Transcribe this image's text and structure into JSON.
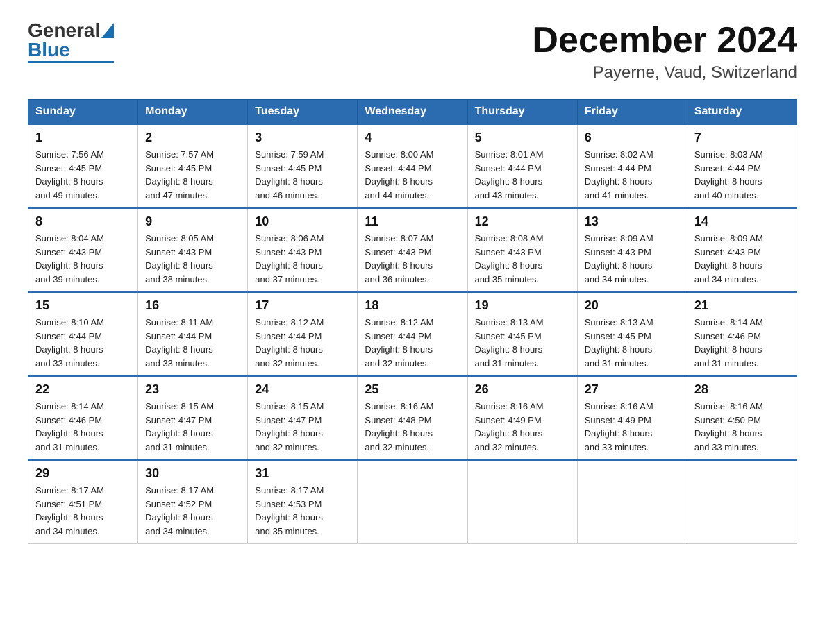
{
  "header": {
    "logo_general": "General",
    "logo_blue": "Blue",
    "title": "December 2024",
    "location": "Payerne, Vaud, Switzerland"
  },
  "days_of_week": [
    "Sunday",
    "Monday",
    "Tuesday",
    "Wednesday",
    "Thursday",
    "Friday",
    "Saturday"
  ],
  "weeks": [
    [
      {
        "day": "1",
        "sunrise": "7:56 AM",
        "sunset": "4:45 PM",
        "daylight": "8 hours and 49 minutes."
      },
      {
        "day": "2",
        "sunrise": "7:57 AM",
        "sunset": "4:45 PM",
        "daylight": "8 hours and 47 minutes."
      },
      {
        "day": "3",
        "sunrise": "7:59 AM",
        "sunset": "4:45 PM",
        "daylight": "8 hours and 46 minutes."
      },
      {
        "day": "4",
        "sunrise": "8:00 AM",
        "sunset": "4:44 PM",
        "daylight": "8 hours and 44 minutes."
      },
      {
        "day": "5",
        "sunrise": "8:01 AM",
        "sunset": "4:44 PM",
        "daylight": "8 hours and 43 minutes."
      },
      {
        "day": "6",
        "sunrise": "8:02 AM",
        "sunset": "4:44 PM",
        "daylight": "8 hours and 41 minutes."
      },
      {
        "day": "7",
        "sunrise": "8:03 AM",
        "sunset": "4:44 PM",
        "daylight": "8 hours and 40 minutes."
      }
    ],
    [
      {
        "day": "8",
        "sunrise": "8:04 AM",
        "sunset": "4:43 PM",
        "daylight": "8 hours and 39 minutes."
      },
      {
        "day": "9",
        "sunrise": "8:05 AM",
        "sunset": "4:43 PM",
        "daylight": "8 hours and 38 minutes."
      },
      {
        "day": "10",
        "sunrise": "8:06 AM",
        "sunset": "4:43 PM",
        "daylight": "8 hours and 37 minutes."
      },
      {
        "day": "11",
        "sunrise": "8:07 AM",
        "sunset": "4:43 PM",
        "daylight": "8 hours and 36 minutes."
      },
      {
        "day": "12",
        "sunrise": "8:08 AM",
        "sunset": "4:43 PM",
        "daylight": "8 hours and 35 minutes."
      },
      {
        "day": "13",
        "sunrise": "8:09 AM",
        "sunset": "4:43 PM",
        "daylight": "8 hours and 34 minutes."
      },
      {
        "day": "14",
        "sunrise": "8:09 AM",
        "sunset": "4:43 PM",
        "daylight": "8 hours and 34 minutes."
      }
    ],
    [
      {
        "day": "15",
        "sunrise": "8:10 AM",
        "sunset": "4:44 PM",
        "daylight": "8 hours and 33 minutes."
      },
      {
        "day": "16",
        "sunrise": "8:11 AM",
        "sunset": "4:44 PM",
        "daylight": "8 hours and 33 minutes."
      },
      {
        "day": "17",
        "sunrise": "8:12 AM",
        "sunset": "4:44 PM",
        "daylight": "8 hours and 32 minutes."
      },
      {
        "day": "18",
        "sunrise": "8:12 AM",
        "sunset": "4:44 PM",
        "daylight": "8 hours and 32 minutes."
      },
      {
        "day": "19",
        "sunrise": "8:13 AM",
        "sunset": "4:45 PM",
        "daylight": "8 hours and 31 minutes."
      },
      {
        "day": "20",
        "sunrise": "8:13 AM",
        "sunset": "4:45 PM",
        "daylight": "8 hours and 31 minutes."
      },
      {
        "day": "21",
        "sunrise": "8:14 AM",
        "sunset": "4:46 PM",
        "daylight": "8 hours and 31 minutes."
      }
    ],
    [
      {
        "day": "22",
        "sunrise": "8:14 AM",
        "sunset": "4:46 PM",
        "daylight": "8 hours and 31 minutes."
      },
      {
        "day": "23",
        "sunrise": "8:15 AM",
        "sunset": "4:47 PM",
        "daylight": "8 hours and 31 minutes."
      },
      {
        "day": "24",
        "sunrise": "8:15 AM",
        "sunset": "4:47 PM",
        "daylight": "8 hours and 32 minutes."
      },
      {
        "day": "25",
        "sunrise": "8:16 AM",
        "sunset": "4:48 PM",
        "daylight": "8 hours and 32 minutes."
      },
      {
        "day": "26",
        "sunrise": "8:16 AM",
        "sunset": "4:49 PM",
        "daylight": "8 hours and 32 minutes."
      },
      {
        "day": "27",
        "sunrise": "8:16 AM",
        "sunset": "4:49 PM",
        "daylight": "8 hours and 33 minutes."
      },
      {
        "day": "28",
        "sunrise": "8:16 AM",
        "sunset": "4:50 PM",
        "daylight": "8 hours and 33 minutes."
      }
    ],
    [
      {
        "day": "29",
        "sunrise": "8:17 AM",
        "sunset": "4:51 PM",
        "daylight": "8 hours and 34 minutes."
      },
      {
        "day": "30",
        "sunrise": "8:17 AM",
        "sunset": "4:52 PM",
        "daylight": "8 hours and 34 minutes."
      },
      {
        "day": "31",
        "sunrise": "8:17 AM",
        "sunset": "4:53 PM",
        "daylight": "8 hours and 35 minutes."
      },
      null,
      null,
      null,
      null
    ]
  ],
  "labels": {
    "sunrise_prefix": "Sunrise: ",
    "sunset_prefix": "Sunset: ",
    "daylight_prefix": "Daylight: "
  }
}
